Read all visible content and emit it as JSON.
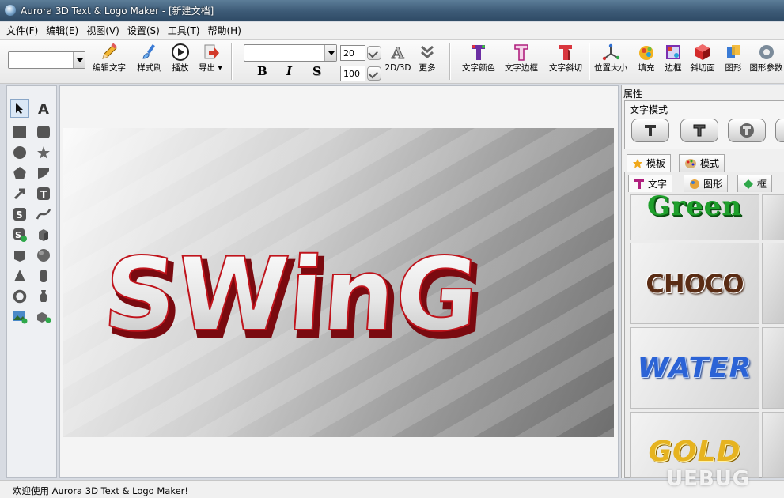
{
  "window": {
    "title": "Aurora 3D Text & Logo Maker - [新建文档]"
  },
  "menu": [
    "文件(F)",
    "编辑(E)",
    "视图(V)",
    "设置(S)",
    "工具(T)",
    "帮助(H)"
  ],
  "toolbar": {
    "edit_text": "编辑文字",
    "style_brush": "样式刷",
    "play": "播放",
    "export": "导出",
    "font_size": "20",
    "scale": "100",
    "bold": "B",
    "italic": "I",
    "shadow": "S",
    "mode_2d3d": "2D/3D",
    "more": "更多",
    "text_color": "文字颜色",
    "text_border": "文字边框",
    "text_bevel": "文字斜切",
    "pos_size": "位置大小",
    "fill": "填充",
    "border": "边框",
    "bevel_face": "斜切面",
    "shape": "图形",
    "shape_params": "图形参数"
  },
  "canvas": {
    "text": "SWinG"
  },
  "panel": {
    "title": "属性",
    "text_mode_label": "文字模式",
    "tab_templates": "模板",
    "tab_styles": "模式",
    "subtab_text": "文字",
    "subtab_shape": "图形",
    "subtab_frame": "框",
    "templates": [
      "Green",
      "CHOCO",
      "WATER",
      "GOLD"
    ]
  },
  "status": {
    "text": "欢迎使用 Aurora 3D Text & Logo Maker!"
  },
  "watermark": "UEBUG",
  "colors": {
    "title_bar": "#3d5b77",
    "accent_red": "#c0141c"
  }
}
